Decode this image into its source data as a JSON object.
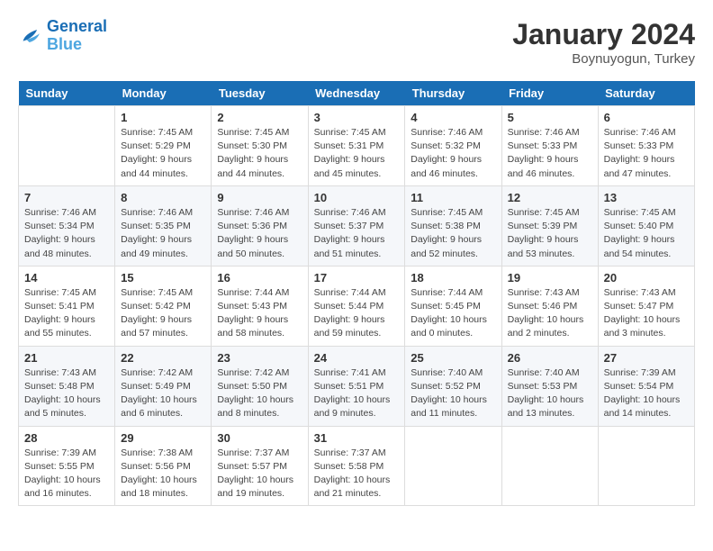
{
  "logo": {
    "text1": "General",
    "text2": "Blue"
  },
  "title": "January 2024",
  "subtitle": "Boynuyogun, Turkey",
  "headers": [
    "Sunday",
    "Monday",
    "Tuesday",
    "Wednesday",
    "Thursday",
    "Friday",
    "Saturday"
  ],
  "weeks": [
    [
      {
        "day": "",
        "info": ""
      },
      {
        "day": "1",
        "info": "Sunrise: 7:45 AM\nSunset: 5:29 PM\nDaylight: 9 hours\nand 44 minutes."
      },
      {
        "day": "2",
        "info": "Sunrise: 7:45 AM\nSunset: 5:30 PM\nDaylight: 9 hours\nand 44 minutes."
      },
      {
        "day": "3",
        "info": "Sunrise: 7:45 AM\nSunset: 5:31 PM\nDaylight: 9 hours\nand 45 minutes."
      },
      {
        "day": "4",
        "info": "Sunrise: 7:46 AM\nSunset: 5:32 PM\nDaylight: 9 hours\nand 46 minutes."
      },
      {
        "day": "5",
        "info": "Sunrise: 7:46 AM\nSunset: 5:33 PM\nDaylight: 9 hours\nand 46 minutes."
      },
      {
        "day": "6",
        "info": "Sunrise: 7:46 AM\nSunset: 5:33 PM\nDaylight: 9 hours\nand 47 minutes."
      }
    ],
    [
      {
        "day": "7",
        "info": "Sunrise: 7:46 AM\nSunset: 5:34 PM\nDaylight: 9 hours\nand 48 minutes."
      },
      {
        "day": "8",
        "info": "Sunrise: 7:46 AM\nSunset: 5:35 PM\nDaylight: 9 hours\nand 49 minutes."
      },
      {
        "day": "9",
        "info": "Sunrise: 7:46 AM\nSunset: 5:36 PM\nDaylight: 9 hours\nand 50 minutes."
      },
      {
        "day": "10",
        "info": "Sunrise: 7:46 AM\nSunset: 5:37 PM\nDaylight: 9 hours\nand 51 minutes."
      },
      {
        "day": "11",
        "info": "Sunrise: 7:45 AM\nSunset: 5:38 PM\nDaylight: 9 hours\nand 52 minutes."
      },
      {
        "day": "12",
        "info": "Sunrise: 7:45 AM\nSunset: 5:39 PM\nDaylight: 9 hours\nand 53 minutes."
      },
      {
        "day": "13",
        "info": "Sunrise: 7:45 AM\nSunset: 5:40 PM\nDaylight: 9 hours\nand 54 minutes."
      }
    ],
    [
      {
        "day": "14",
        "info": "Sunrise: 7:45 AM\nSunset: 5:41 PM\nDaylight: 9 hours\nand 55 minutes."
      },
      {
        "day": "15",
        "info": "Sunrise: 7:45 AM\nSunset: 5:42 PM\nDaylight: 9 hours\nand 57 minutes."
      },
      {
        "day": "16",
        "info": "Sunrise: 7:44 AM\nSunset: 5:43 PM\nDaylight: 9 hours\nand 58 minutes."
      },
      {
        "day": "17",
        "info": "Sunrise: 7:44 AM\nSunset: 5:44 PM\nDaylight: 9 hours\nand 59 minutes."
      },
      {
        "day": "18",
        "info": "Sunrise: 7:44 AM\nSunset: 5:45 PM\nDaylight: 10 hours\nand 0 minutes."
      },
      {
        "day": "19",
        "info": "Sunrise: 7:43 AM\nSunset: 5:46 PM\nDaylight: 10 hours\nand 2 minutes."
      },
      {
        "day": "20",
        "info": "Sunrise: 7:43 AM\nSunset: 5:47 PM\nDaylight: 10 hours\nand 3 minutes."
      }
    ],
    [
      {
        "day": "21",
        "info": "Sunrise: 7:43 AM\nSunset: 5:48 PM\nDaylight: 10 hours\nand 5 minutes."
      },
      {
        "day": "22",
        "info": "Sunrise: 7:42 AM\nSunset: 5:49 PM\nDaylight: 10 hours\nand 6 minutes."
      },
      {
        "day": "23",
        "info": "Sunrise: 7:42 AM\nSunset: 5:50 PM\nDaylight: 10 hours\nand 8 minutes."
      },
      {
        "day": "24",
        "info": "Sunrise: 7:41 AM\nSunset: 5:51 PM\nDaylight: 10 hours\nand 9 minutes."
      },
      {
        "day": "25",
        "info": "Sunrise: 7:40 AM\nSunset: 5:52 PM\nDaylight: 10 hours\nand 11 minutes."
      },
      {
        "day": "26",
        "info": "Sunrise: 7:40 AM\nSunset: 5:53 PM\nDaylight: 10 hours\nand 13 minutes."
      },
      {
        "day": "27",
        "info": "Sunrise: 7:39 AM\nSunset: 5:54 PM\nDaylight: 10 hours\nand 14 minutes."
      }
    ],
    [
      {
        "day": "28",
        "info": "Sunrise: 7:39 AM\nSunset: 5:55 PM\nDaylight: 10 hours\nand 16 minutes."
      },
      {
        "day": "29",
        "info": "Sunrise: 7:38 AM\nSunset: 5:56 PM\nDaylight: 10 hours\nand 18 minutes."
      },
      {
        "day": "30",
        "info": "Sunrise: 7:37 AM\nSunset: 5:57 PM\nDaylight: 10 hours\nand 19 minutes."
      },
      {
        "day": "31",
        "info": "Sunrise: 7:37 AM\nSunset: 5:58 PM\nDaylight: 10 hours\nand 21 minutes."
      },
      {
        "day": "",
        "info": ""
      },
      {
        "day": "",
        "info": ""
      },
      {
        "day": "",
        "info": ""
      }
    ]
  ]
}
